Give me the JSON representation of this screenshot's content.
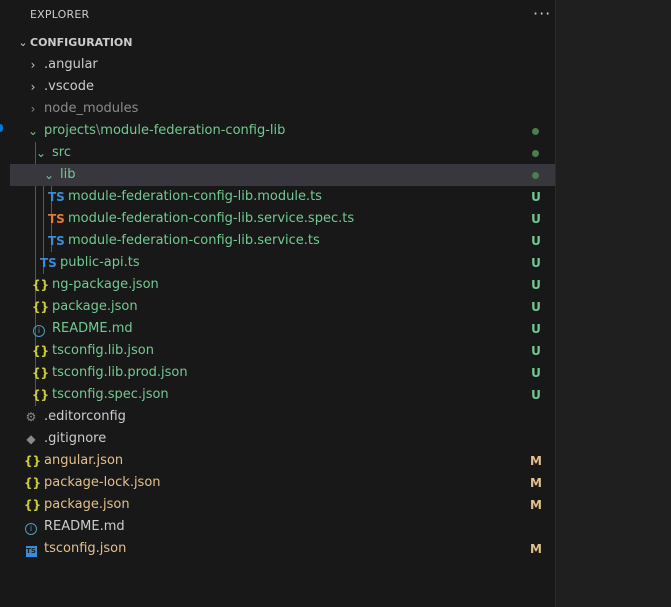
{
  "explorer": {
    "title": "EXPLORER",
    "more_actions": "···",
    "section": "CONFIGURATION"
  },
  "tree": [
    {
      "label": ".angular",
      "type": "folder",
      "expanded": false,
      "depth": 0
    },
    {
      "label": ".vscode",
      "type": "folder",
      "expanded": false,
      "depth": 0
    },
    {
      "label": "node_modules",
      "type": "folder",
      "expanded": false,
      "depth": 0
    },
    {
      "label": "projects",
      "sep": "\\",
      "label2": "module-federation-config-lib",
      "type": "folder",
      "expanded": true,
      "depth": 0,
      "status_dot": true
    },
    {
      "label": "src",
      "type": "folder",
      "expanded": true,
      "depth": 1,
      "status_dot": true
    },
    {
      "label": "lib",
      "type": "folder",
      "expanded": true,
      "depth": 2,
      "status_dot": true,
      "selected": true
    },
    {
      "label": "module-federation-config-lib.module.ts",
      "icon_text": "TS",
      "status": "U"
    },
    {
      "label": "module-federation-config-lib.service.spec.ts",
      "icon_text": "TS",
      "status": "U"
    },
    {
      "label": "module-federation-config-lib.service.ts",
      "icon_text": "TS",
      "status": "U"
    },
    {
      "label": "public-api.ts",
      "icon_text": "TS",
      "status": "U"
    },
    {
      "label": "ng-package.json",
      "icon_text": "{}",
      "status": "U"
    },
    {
      "label": "package.json",
      "icon_text": "{}",
      "status": "U"
    },
    {
      "label": "README.md",
      "icon_text": "i",
      "status": "U"
    },
    {
      "label": "tsconfig.lib.json",
      "icon_text": "{}",
      "status": "U"
    },
    {
      "label": "tsconfig.lib.prod.json",
      "icon_text": "{}",
      "status": "U"
    },
    {
      "label": "tsconfig.spec.json",
      "icon_text": "{}",
      "status": "U"
    },
    {
      "label": ".editorconfig",
      "icon": "gear-icon"
    },
    {
      "label": ".gitignore",
      "icon": "git-icon"
    },
    {
      "label": "angular.json",
      "icon_text": "{}",
      "status": "M"
    },
    {
      "label": "package-lock.json",
      "icon_text": "{}",
      "status": "M"
    },
    {
      "label": "package.json",
      "icon_text": "{}",
      "status": "M"
    },
    {
      "label": "README.md",
      "icon_text": "i"
    },
    {
      "label": "tsconfig.json",
      "icon_text": "TS",
      "status": "M"
    }
  ],
  "colors": {
    "untracked": "#73c991",
    "modified": "#e2c08d",
    "ts_icon": "#3c8bd6",
    "spec_icon": "#e37933",
    "json_icon": "#cbcb41",
    "selection": "#37373d"
  }
}
